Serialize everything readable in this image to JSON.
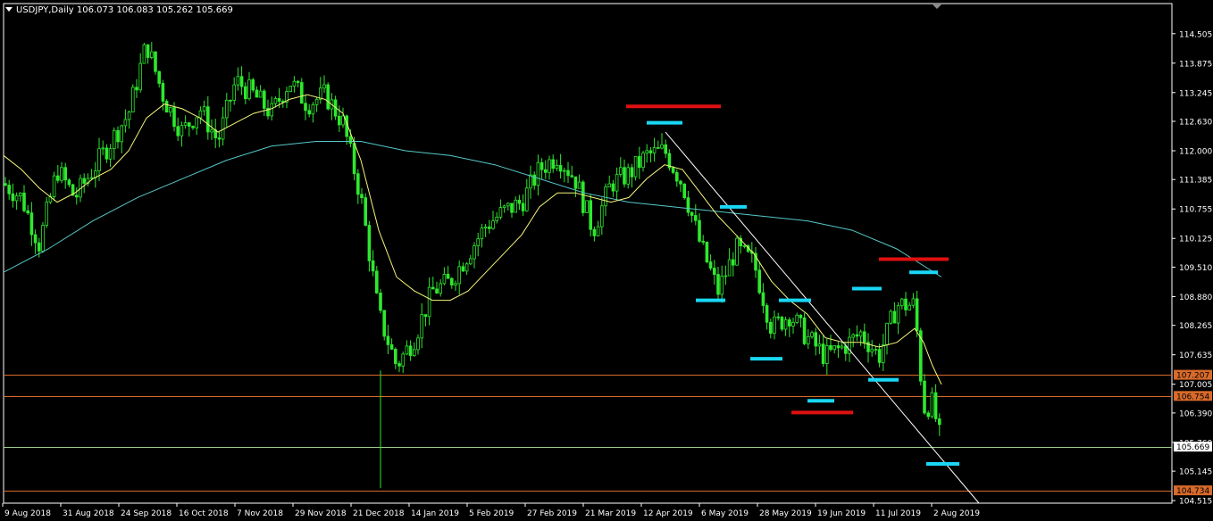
{
  "header": {
    "symbol": "USDJPY,Daily",
    "ohlc": "106.073 106.083 105.262 105.669"
  },
  "colors": {
    "background": "#000000",
    "axis": "#ffffff",
    "candle": "#2ee82e",
    "ma_fast": "#f5f57a",
    "ma_slow": "#56c8c8",
    "trend": "#ffffff",
    "hline": "#d86a2a",
    "hline_label_bg": "#d86a2a",
    "price_line": "#9acd8a",
    "price_label_bg": "#ffffff",
    "resistance": "#e01010",
    "support": "#19d7f5"
  },
  "chart_data": {
    "type": "candlestick",
    "ylim": [
      104.46,
      115.15
    ],
    "xlim": [
      0,
      1308
    ],
    "y_ticks": [
      "114.505",
      "113.875",
      "113.245",
      "112.630",
      "112.000",
      "111.385",
      "110.755",
      "110.125",
      "109.510",
      "108.880",
      "108.265",
      "107.635",
      "107.005",
      "106.390",
      "105.760",
      "105.145",
      "104.515"
    ],
    "x_ticks": [
      "9 Aug 2018",
      "31 Aug 2018",
      "24 Sep 2018",
      "16 Oct 2018",
      "7 Nov 2018",
      "29 Nov 2018",
      "21 Dec 2018",
      "14 Jan 2019",
      "5 Feb 2019",
      "27 Feb 2019",
      "21 Mar 2019",
      "12 Apr 2019",
      "6 May 2019",
      "28 May 2019",
      "19 Jun 2019",
      "11 Jul 2019",
      "2 Aug 2019"
    ],
    "closes": [
      [
        0,
        111.3
      ],
      [
        20,
        111.0
      ],
      [
        40,
        110.0
      ],
      [
        60,
        111.6
      ],
      [
        80,
        111.0
      ],
      [
        100,
        111.6
      ],
      [
        120,
        112.2
      ],
      [
        140,
        112.8
      ],
      [
        160,
        114.3
      ],
      [
        180,
        113.1
      ],
      [
        200,
        112.4
      ],
      [
        220,
        112.9
      ],
      [
        240,
        112.2
      ],
      [
        260,
        113.5
      ],
      [
        280,
        113.2
      ],
      [
        300,
        112.8
      ],
      [
        320,
        113.5
      ],
      [
        340,
        113.0
      ],
      [
        360,
        113.2
      ],
      [
        380,
        112.6
      ],
      [
        400,
        111.0
      ],
      [
        420,
        108.5
      ],
      [
        440,
        107.4
      ],
      [
        460,
        108.0
      ],
      [
        480,
        109.0
      ],
      [
        500,
        109.2
      ],
      [
        520,
        109.8
      ],
      [
        540,
        110.4
      ],
      [
        560,
        110.7
      ],
      [
        580,
        110.9
      ],
      [
        600,
        111.6
      ],
      [
        620,
        111.9
      ],
      [
        640,
        111.4
      ],
      [
        660,
        110.3
      ],
      [
        680,
        111.3
      ],
      [
        700,
        111.5
      ],
      [
        720,
        111.9
      ],
      [
        740,
        112.0
      ],
      [
        760,
        111.3
      ],
      [
        780,
        110.0
      ],
      [
        800,
        109.0
      ],
      [
        820,
        109.9
      ],
      [
        840,
        109.6
      ],
      [
        860,
        108.2
      ],
      [
        880,
        108.5
      ],
      [
        900,
        108.0
      ],
      [
        920,
        107.6
      ],
      [
        940,
        107.8
      ],
      [
        960,
        108.1
      ],
      [
        980,
        107.6
      ],
      [
        1000,
        108.7
      ],
      [
        1020,
        108.7
      ],
      [
        1030,
        106.5
      ],
      [
        1040,
        106.6
      ],
      [
        1050,
        105.7
      ]
    ],
    "ma_fast": [
      [
        0,
        111.9
      ],
      [
        20,
        111.6
      ],
      [
        40,
        111.2
      ],
      [
        60,
        110.9
      ],
      [
        80,
        111.1
      ],
      [
        100,
        111.4
      ],
      [
        120,
        111.6
      ],
      [
        140,
        112.0
      ],
      [
        160,
        112.7
      ],
      [
        180,
        113.0
      ],
      [
        200,
        112.9
      ],
      [
        220,
        112.7
      ],
      [
        240,
        112.4
      ],
      [
        260,
        112.6
      ],
      [
        280,
        112.8
      ],
      [
        300,
        112.9
      ],
      [
        320,
        113.1
      ],
      [
        340,
        113.2
      ],
      [
        360,
        113.1
      ],
      [
        380,
        112.8
      ],
      [
        400,
        111.8
      ],
      [
        420,
        110.3
      ],
      [
        440,
        109.3
      ],
      [
        460,
        109.0
      ],
      [
        480,
        108.8
      ],
      [
        500,
        108.8
      ],
      [
        520,
        109.0
      ],
      [
        540,
        109.4
      ],
      [
        560,
        109.8
      ],
      [
        580,
        110.2
      ],
      [
        600,
        110.8
      ],
      [
        620,
        111.1
      ],
      [
        640,
        111.1
      ],
      [
        660,
        111.0
      ],
      [
        680,
        110.9
      ],
      [
        700,
        111.0
      ],
      [
        720,
        111.4
      ],
      [
        740,
        111.7
      ],
      [
        760,
        111.6
      ],
      [
        780,
        111.1
      ],
      [
        800,
        110.6
      ],
      [
        820,
        110.2
      ],
      [
        840,
        109.8
      ],
      [
        860,
        109.2
      ],
      [
        880,
        108.8
      ],
      [
        900,
        108.5
      ],
      [
        920,
        108.0
      ],
      [
        940,
        107.9
      ],
      [
        960,
        107.9
      ],
      [
        980,
        107.8
      ],
      [
        1000,
        107.9
      ],
      [
        1020,
        108.2
      ],
      [
        1030,
        107.9
      ],
      [
        1040,
        107.4
      ],
      [
        1050,
        107.0
      ]
    ],
    "ma_slow": [
      [
        0,
        109.4
      ],
      [
        50,
        109.9
      ],
      [
        100,
        110.5
      ],
      [
        150,
        111.0
      ],
      [
        200,
        111.4
      ],
      [
        250,
        111.8
      ],
      [
        300,
        112.1
      ],
      [
        350,
        112.2
      ],
      [
        400,
        112.2
      ],
      [
        450,
        112.0
      ],
      [
        500,
        111.9
      ],
      [
        550,
        111.7
      ],
      [
        600,
        111.4
      ],
      [
        650,
        111.1
      ],
      [
        700,
        110.9
      ],
      [
        750,
        110.8
      ],
      [
        800,
        110.7
      ],
      [
        850,
        110.6
      ],
      [
        900,
        110.5
      ],
      [
        950,
        110.3
      ],
      [
        1000,
        109.9
      ],
      [
        1050,
        109.3
      ]
    ],
    "trend_line": [
      [
        741,
        112.4
      ],
      [
        1092,
        104.46
      ]
    ],
    "orange_lines": [
      107.207,
      106.754,
      104.734
    ],
    "orange_labels": [
      "107.207",
      "106.754",
      "104.734"
    ],
    "price_line": 105.669,
    "price_label": "105.669",
    "resistance_marks": [
      [
        697,
        803,
        112.95
      ],
      [
        882,
        951,
        106.4
      ],
      [
        980,
        1058,
        109.68
      ]
    ],
    "support_marks": [
      [
        720,
        760,
        112.6
      ],
      [
        775,
        808,
        108.8
      ],
      [
        802,
        832,
        110.8
      ],
      [
        836,
        872,
        107.55
      ],
      [
        868,
        904,
        108.8
      ],
      [
        900,
        930,
        106.65
      ],
      [
        950,
        983,
        109.05
      ],
      [
        968,
        1002,
        107.1
      ],
      [
        1014,
        1046,
        109.4
      ],
      [
        1033,
        1070,
        105.3
      ]
    ]
  }
}
